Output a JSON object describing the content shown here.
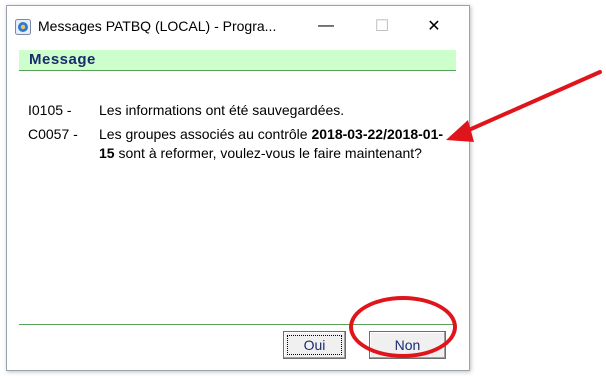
{
  "window": {
    "title": "Messages PATBQ (LOCAL) - Progra...",
    "controls": {
      "minimize": "—",
      "maximize": "☐",
      "close": "✕"
    }
  },
  "header": {
    "title": "Message"
  },
  "messages": [
    {
      "code": "I0105 -",
      "text": "Les informations ont été sauvegardées."
    },
    {
      "code": "C0057 -",
      "text_before": "Les groupes associés au contrôle ",
      "text_bold": "2018-03-22/2018-01-15",
      "text_after": " sont à reformer, voulez-vous le faire maintenant?"
    }
  ],
  "buttons": {
    "yes": "Oui",
    "no": "Non"
  },
  "colors": {
    "header_bg": "#ccffcc",
    "header_text": "#1c2a6e",
    "annotation": "#e0141b",
    "divider": "#5aa25a"
  },
  "annotations": {
    "arrow": "red-arrow",
    "circle": "red-circle-around-non"
  }
}
